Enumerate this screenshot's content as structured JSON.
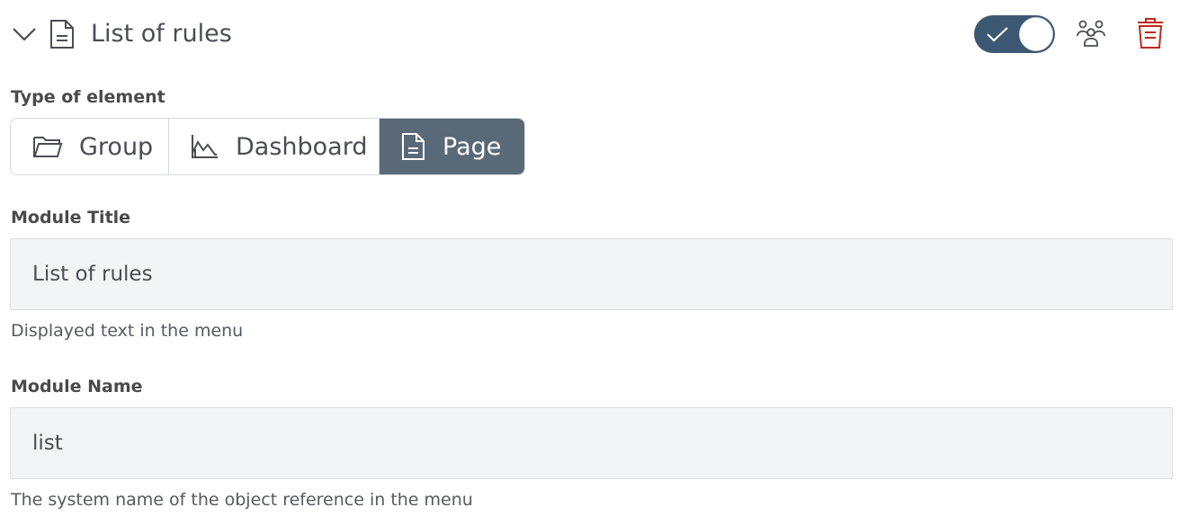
{
  "header": {
    "title": "List of rules",
    "collapse_icon": "chevron-down-icon",
    "page_icon": "document-icon",
    "toggle_on": true,
    "permissions_icon": "users-icon",
    "delete_icon": "trash-icon",
    "delete_color": "#c0281f",
    "toggle_color": "#3d5873"
  },
  "type_of_element": {
    "label": "Type of element",
    "options": [
      {
        "label": "Group",
        "icon": "folder-icon"
      },
      {
        "label": "Dashboard",
        "icon": "chart-icon"
      },
      {
        "label": "Page",
        "icon": "document-icon"
      }
    ],
    "selected": "Page",
    "active_color": "#5a6977"
  },
  "module_title": {
    "label": "Module Title",
    "value": "List of rules",
    "hint": "Displayed text in the menu"
  },
  "module_name": {
    "label": "Module Name",
    "value": "list",
    "hint": "The system name of the object reference in the menu"
  }
}
